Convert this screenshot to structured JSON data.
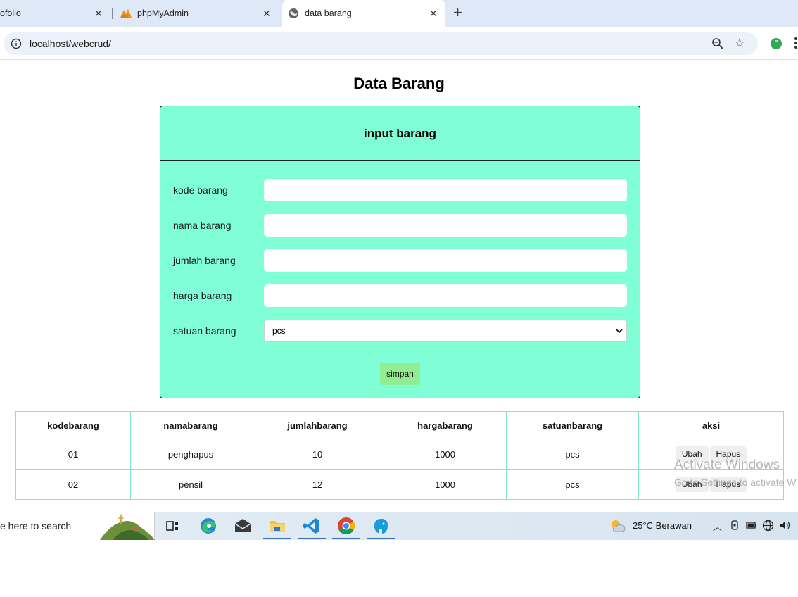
{
  "browser": {
    "tabs": [
      {
        "title": "ofolio",
        "favicon": "none"
      },
      {
        "title": "phpMyAdmin",
        "favicon": "phpmyadmin-icon"
      },
      {
        "title": "data barang",
        "favicon": "globe-icon",
        "active": true
      }
    ],
    "url": "localhost/webcrud/"
  },
  "page": {
    "heading": "Data Barang",
    "form": {
      "title": "input barang",
      "fields": [
        {
          "label": "kode barang",
          "value": ""
        },
        {
          "label": "nama barang",
          "value": ""
        },
        {
          "label": "jumlah barang",
          "value": ""
        },
        {
          "label": "harga barang",
          "value": ""
        },
        {
          "label": "satuan barang",
          "value": "pcs"
        }
      ],
      "submit_label": "simpan",
      "bg_color": "#80ffd6"
    },
    "table": {
      "headers": [
        "kodebarang",
        "namabarang",
        "jumlahbarang",
        "hargabarang",
        "satuanbarang",
        "aksi"
      ],
      "rows": [
        {
          "kode": "01",
          "nama": "penghapus",
          "jumlah": "10",
          "harga": "1000",
          "satuan": "pcs",
          "edit": "Ubah",
          "delete": "Hapus"
        },
        {
          "kode": "02",
          "nama": "pensil",
          "jumlah": "12",
          "harga": "1000",
          "satuan": "pcs",
          "edit": "Ubah",
          "delete": "Hapus"
        }
      ]
    },
    "watermark": {
      "line1": "Activate Windows",
      "line2": "Go to Settings to activate W"
    }
  },
  "taskbar": {
    "search_text": "e here to search",
    "apps": [
      "task-view-icon",
      "edge-icon",
      "mail-icon",
      "file-explorer-icon",
      "vscode-icon",
      "chrome-icon",
      "mysql-workbench-icon"
    ],
    "weather": "25°C  Berawan"
  }
}
